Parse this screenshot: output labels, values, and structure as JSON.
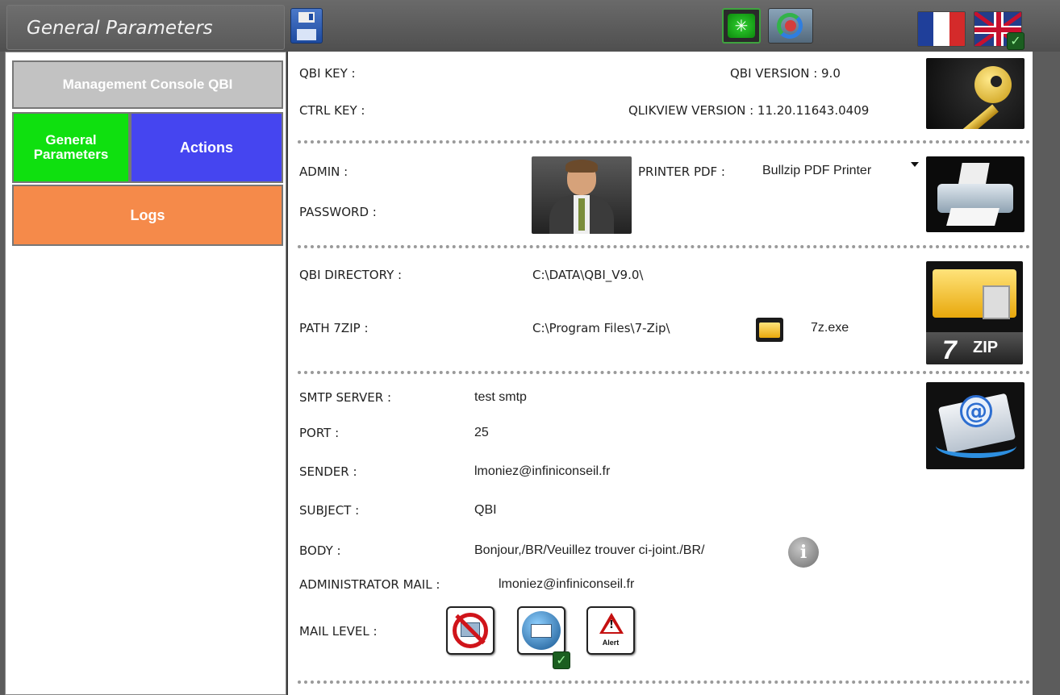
{
  "header": {
    "title": "General Parameters",
    "icons": [
      "save-icon",
      "reload-icon",
      "refresh-icon",
      "flag-fr-icon",
      "flag-en-icon"
    ],
    "language_selected": "en"
  },
  "sidebar": {
    "management": "Management Console QBI",
    "general": "General Parameters",
    "actions": "Actions",
    "logs": "Logs",
    "colors": {
      "management": "#c2c2c2",
      "general": "#0fe00f",
      "actions": "#4545f0",
      "logs": "#f58a4a"
    }
  },
  "keys": {
    "qbi_key_label": "QBI KEY :",
    "ctrl_key_label": "CTRL KEY :",
    "qbi_version_label": "QBI VERSION : 9.0",
    "qlikview_version_label": "QLIKVIEW VERSION : 11.20.11643.0409"
  },
  "admin": {
    "admin_label": "ADMIN :",
    "password_label": "PASSWORD :",
    "printer_label": "PRINTER PDF :",
    "printer_value": "Bullzip PDF Printer"
  },
  "paths": {
    "qbi_directory_label": "QBI DIRECTORY :",
    "qbi_directory_value": "C:\\DATA\\QBI_V9.0\\",
    "path_7zip_label": "PATH 7ZIP :",
    "path_7zip_value": "C:\\Program Files\\7-Zip\\",
    "exe_value": "7z.exe",
    "zip_seven": "7",
    "zip_text": "ZIP"
  },
  "smtp": {
    "server_label": "SMTP SERVER :",
    "server_value": "test smtp",
    "port_label": "PORT :",
    "port_value": "25",
    "sender_label": "SENDER :",
    "sender_value": "lmoniez@infiniconseil.fr",
    "subject_label": "SUBJECT :",
    "subject_value": "QBI",
    "body_label": "BODY :",
    "body_value": "Bonjour,/BR/Veuillez trouver ci-joint./BR/",
    "admin_mail_label": "ADMINISTRATOR MAIL :",
    "admin_mail_value": "lmoniez@infiniconseil.fr",
    "mail_level_label": "MAIL LEVEL :",
    "mail_level_selected": "all",
    "alert_text": "Alert",
    "info_glyph": "i",
    "at_glyph": "@"
  }
}
